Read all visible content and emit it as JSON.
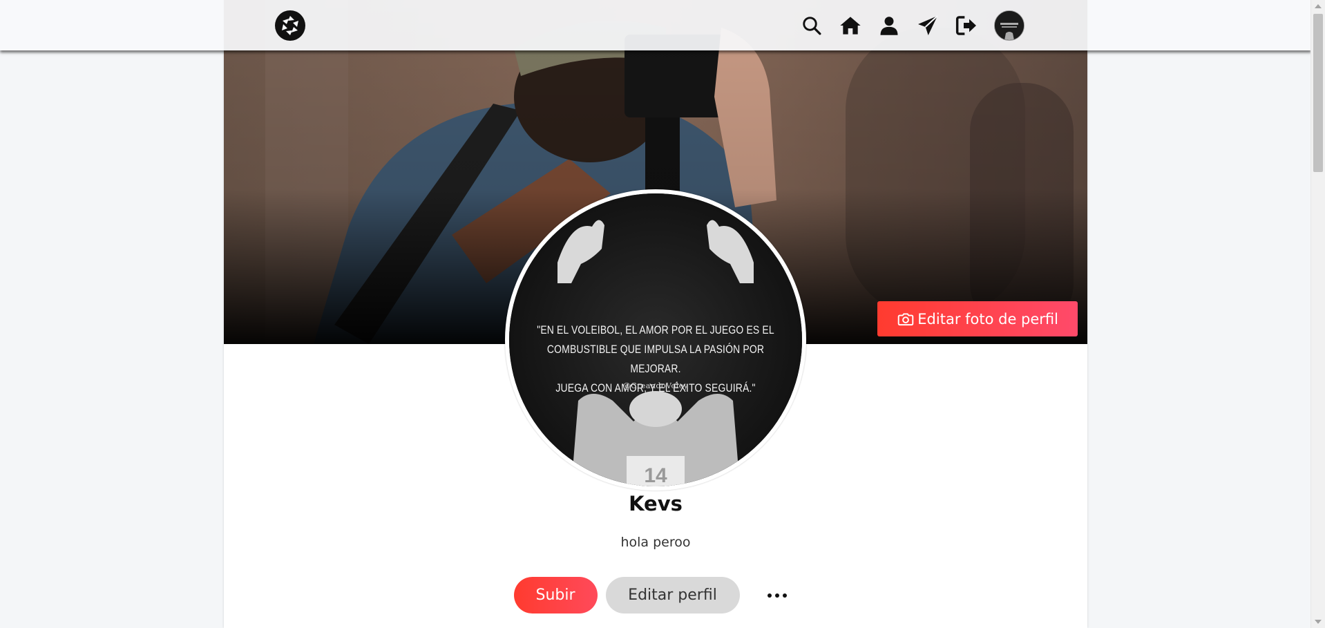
{
  "nav": {
    "logo_icon": "camera-aperture-icon",
    "icons": [
      "search-icon",
      "home-icon",
      "user-icon",
      "send-icon",
      "logout-icon"
    ],
    "avatar_alt": "Kevs"
  },
  "cover": {
    "edit_button_label": "Editar foto de perfil",
    "edit_button_icon": "camera-icon",
    "accent_start": "#ff3b2f",
    "accent_end": "#ff4a6a"
  },
  "avatar": {
    "quote_line_1": "\"EN EL VOLEIBOL, EL AMOR POR EL JUEGO ES EL",
    "quote_line_2": "COMBUSTIBLE QUE IMPULSA LA PASIÓN POR MEJORAR.",
    "quote_line_3": "JUEGA CON AMOR, Y EL ÉXITO SEGUIRÁ.\"",
    "handle": "@CreandoVoley"
  },
  "profile": {
    "name": "Kevs",
    "bio": "hola peroo"
  },
  "actions": {
    "upload_label": "Subir",
    "edit_profile_label": "Editar perfil",
    "more_icon": "more-horizontal-icon"
  }
}
